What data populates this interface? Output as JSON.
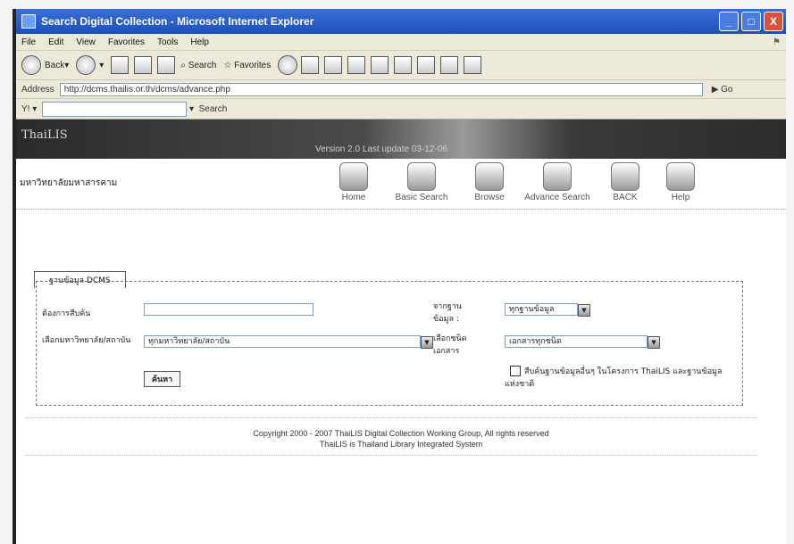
{
  "window": {
    "title": "Search Digital Collection - Microsoft Internet Explorer",
    "buttons": [
      "_",
      "□",
      "X"
    ]
  },
  "menu": [
    "File",
    "Edit",
    "View",
    "Favorites",
    "Tools",
    "Help"
  ],
  "toolbar": {
    "back": "Back",
    "search": "Search",
    "favorites": "Favorites"
  },
  "address": {
    "label": "Address",
    "url": "http://dcms.thailis.or.th/dcms/advance.php",
    "go": "Go"
  },
  "searchbar": {
    "label": "Search"
  },
  "banner": {
    "logo": "ThaiLIS",
    "update": "Version 2.0 Last update 03-12-06"
  },
  "site": {
    "university": "มหาวิทยาลัยมหาสารคาม",
    "nav": [
      {
        "label": "Home"
      },
      {
        "label": "Basic Search"
      },
      {
        "label": "Browse"
      },
      {
        "label": "Advance Search"
      },
      {
        "label": "BACK"
      },
      {
        "label": "Help"
      }
    ]
  },
  "tab": {
    "label": "ฐานข้อมูล DCMS"
  },
  "form": {
    "keyword_label": "ต้องการสืบค้น",
    "keyword_value": "",
    "from_label": "จากฐานข้อมูล :",
    "from_value": "ทุกฐานข้อมูล",
    "institution_label": "เลือกมหาวิทยาลัย/สถาบัน",
    "institution_value": "ทุกมหาวิทยาลัย/สถาบัน",
    "doctype_label": "เลือกชนิดเอกสาร",
    "doctype_value": "เอกสารทุกชนิด",
    "submit_label": "ค้นหา",
    "checkbox_label": "สืบค้นฐานข้อมูลอื่นๆ ในโครงการ ThaiLIS และฐานข้อมูลแห่งชาติ"
  },
  "footer": {
    "line1": "Copyright 2000 - 2007 ThaiLIS Digital Collection Working Group, All rights reserved",
    "line2": "ThaiLIS is Thailand Library Integrated System"
  }
}
